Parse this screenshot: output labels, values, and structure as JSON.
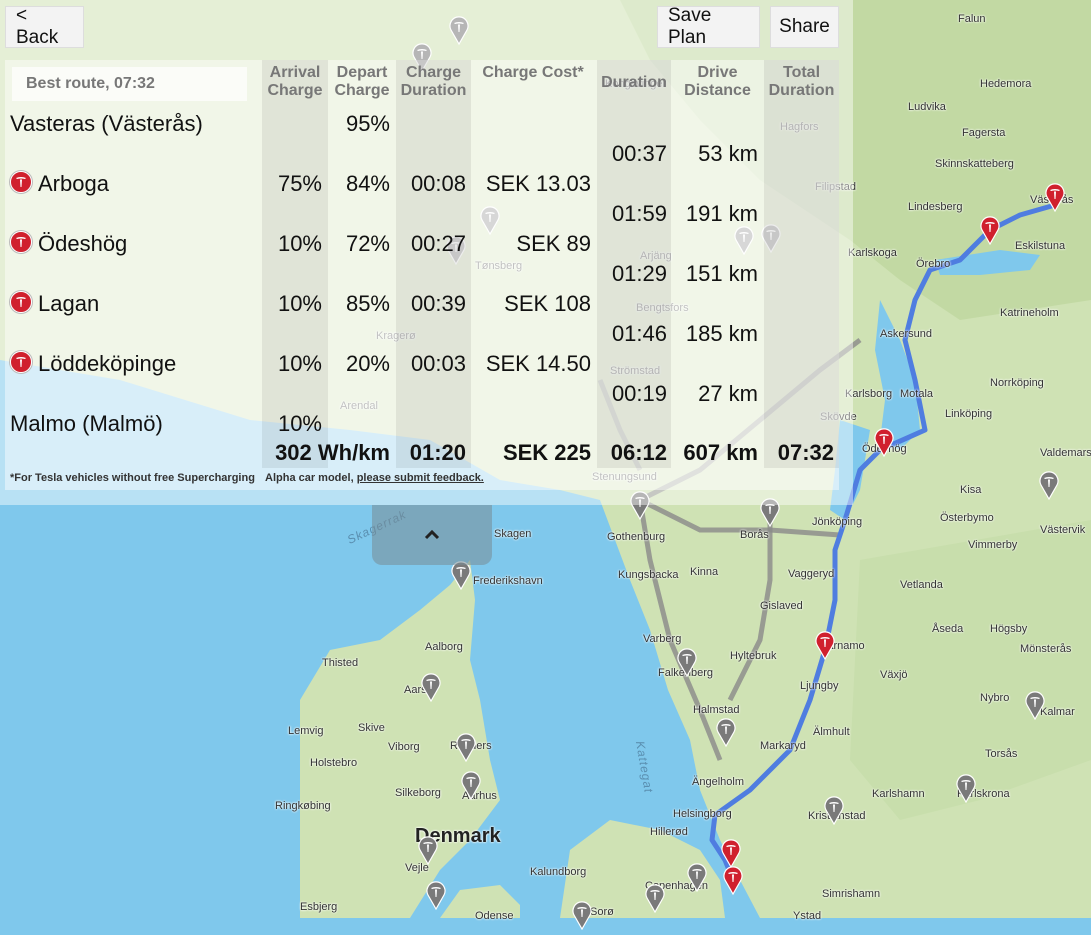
{
  "header": {
    "back_label": "< Back",
    "save_label": "Save Plan",
    "share_label": "Share"
  },
  "route": {
    "title": "Best route, 07:32",
    "columns": {
      "arrival": "Arrival Charge",
      "depart": "Depart Charge",
      "charge_duration": "Charge Duration",
      "charge_cost": "Charge Cost*",
      "duration": "Duration",
      "drive_distance": "Drive Distance",
      "total_duration": "Total Duration"
    },
    "stops": [
      {
        "name": "Vasteras (Västerås)",
        "charger": false,
        "arrival": "",
        "depart": "95%",
        "charge_duration": "",
        "charge_cost": ""
      },
      {
        "name": "Arboga",
        "charger": true,
        "arrival": "75%",
        "depart": "84%",
        "charge_duration": "00:08",
        "charge_cost": "SEK 13.03"
      },
      {
        "name": "Ödeshög",
        "charger": true,
        "arrival": "10%",
        "depart": "72%",
        "charge_duration": "00:27",
        "charge_cost": "SEK 89"
      },
      {
        "name": "Lagan",
        "charger": true,
        "arrival": "10%",
        "depart": "85%",
        "charge_duration": "00:39",
        "charge_cost": "SEK 108"
      },
      {
        "name": "Löddeköpinge",
        "charger": true,
        "arrival": "10%",
        "depart": "20%",
        "charge_duration": "00:03",
        "charge_cost": "SEK 14.50"
      },
      {
        "name": "Malmo (Malmö)",
        "charger": false,
        "arrival": "10%",
        "depart": "",
        "charge_duration": "",
        "charge_cost": ""
      }
    ],
    "legs": [
      {
        "duration": "00:37",
        "distance": "53 km"
      },
      {
        "duration": "01:59",
        "distance": "191 km"
      },
      {
        "duration": "01:29",
        "distance": "151 km"
      },
      {
        "duration": "01:46",
        "distance": "185 km"
      },
      {
        "duration": "00:19",
        "distance": "27 km"
      }
    ],
    "totals": {
      "consumption": "302 Wh/km",
      "charge_duration": "01:20",
      "charge_cost": "SEK 225",
      "duration": "06:12",
      "distance": "607 km",
      "total_duration": "07:32"
    },
    "footnote": "*For Tesla vehicles without free Supercharging",
    "feedback_prefix": "Alpha car model,",
    "feedback_link": "please submit feedback."
  },
  "map": {
    "labels": [
      "Västerås",
      "Eskilstuna",
      "Katrineholm",
      "Norrköping",
      "Linköping",
      "Motala",
      "Askersund",
      "Karlskoga",
      "Örebro",
      "Lindesberg",
      "Fagersta",
      "Skinnskatteberg",
      "Ludvika",
      "Hedemora",
      "Falun",
      "Valdemarsvik",
      "Västervik",
      "Kisa",
      "Österbymo",
      "Vimmerby",
      "Vetlanda",
      "Åseda",
      "Högsby",
      "Mönsterås",
      "Nybro",
      "Kalmar",
      "Torsås",
      "Karlskrona",
      "Karlshamn",
      "Kristianstad",
      "Simrishamn",
      "Ystad",
      "Växjö",
      "Älmhult",
      "Markaryd",
      "Ljungby",
      "Värnamo",
      "Gislaved",
      "Vaggeryd",
      "Jönköping",
      "Hyltebruk",
      "Halmstad",
      "Falkenberg",
      "Varberg",
      "Kinna",
      "Borås",
      "Kungsbacka",
      "Gothenburg",
      "Stenungsund",
      "Ängelholm",
      "Helsingborg",
      "Hillerød",
      "Kalundborg",
      "Copenhagen",
      "Skagen",
      "Frederikshavn",
      "Aalborg",
      "Thisted",
      "Aars",
      "Skive",
      "Lemvig",
      "Viborg",
      "Randers",
      "Holstebro",
      "Silkeborg",
      "Aarhus",
      "Ringkøbing",
      "Vejle",
      "Esbjerg",
      "Odense",
      "Sorø",
      "Denmark",
      "Skagerrak",
      "Kattegat",
      "Karlsborg",
      "Ödeshög",
      "Kongsvinger",
      "Filipstad",
      "Hagfors",
      "Arjäng",
      "Tønsberg",
      "Bengtsfors",
      "Kragerø",
      "Arendal",
      "Strömstad",
      "Skövde"
    ],
    "route_color": "#4f7de0",
    "pin_color": "#d0202e"
  }
}
